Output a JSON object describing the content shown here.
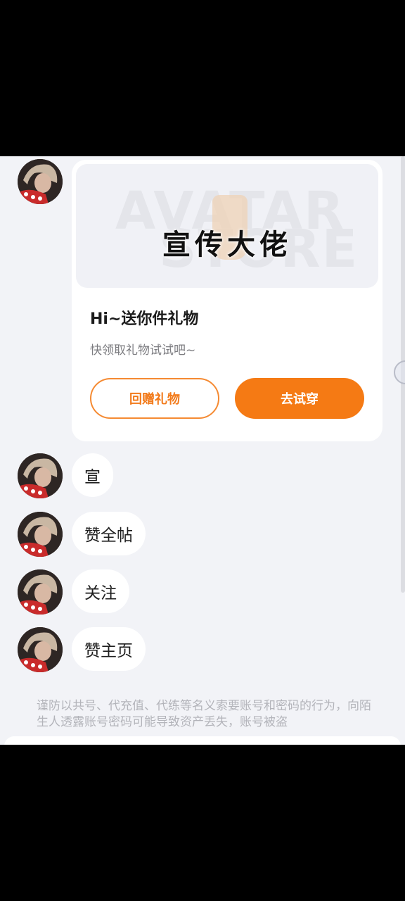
{
  "banner": {
    "watermark_line1": "AVATAR",
    "watermark_line2": "STORE",
    "promo_title": "宣传大佬"
  },
  "gift_card": {
    "title": "Hi~送你件礼物",
    "subtitle": "快领取礼物试试吧~",
    "return_gift_button": "回赠礼物",
    "try_on_button": "去试穿"
  },
  "messages": [
    {
      "text": "宣"
    },
    {
      "text": "赞全帖"
    },
    {
      "text": "关注"
    },
    {
      "text": "赞主页"
    }
  ],
  "notice": "谨防以共号、代充值、代练等名义索要账号和密码的行为，向陌生人透露账号密码可能导致资产丢失，账号被盗",
  "colors": {
    "accent": "#f57a14",
    "background": "#f2f3f7",
    "card": "#ffffff"
  }
}
